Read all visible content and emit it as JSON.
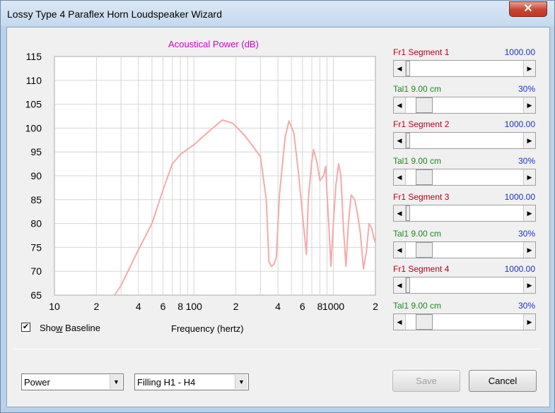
{
  "window": {
    "title": "Lossy Type 4 Paraflex Horn Loudspeaker Wizard",
    "close_glyph": "✕"
  },
  "chart_data": {
    "type": "line",
    "title": "Acoustical Power (dB)",
    "xlabel": "Frequency (hertz)",
    "ylabel": "",
    "x_scale": "log",
    "xlim": [
      10,
      2000
    ],
    "ylim": [
      65,
      115
    ],
    "yticks": [
      115,
      110,
      105,
      100,
      95,
      90,
      85,
      80,
      75,
      70,
      65
    ],
    "xtick_labels": [
      {
        "x": 10,
        "label": "10"
      },
      {
        "x": 20,
        "label": "2"
      },
      {
        "x": 40,
        "label": "4"
      },
      {
        "x": 60,
        "label": "6"
      },
      {
        "x": 80,
        "label": "8"
      },
      {
        "x": 100,
        "label": "100"
      },
      {
        "x": 200,
        "label": "2"
      },
      {
        "x": 400,
        "label": "4"
      },
      {
        "x": 600,
        "label": "6"
      },
      {
        "x": 800,
        "label": "8"
      },
      {
        "x": 1000,
        "label": "1000"
      },
      {
        "x": 2000,
        "label": "2"
      }
    ],
    "grid": true,
    "series": [
      {
        "color": "#f4aaaa",
        "points": [
          [
            27,
            65
          ],
          [
            30,
            67
          ],
          [
            40,
            74.5
          ],
          [
            50,
            80
          ],
          [
            60,
            87
          ],
          [
            70,
            92.5
          ],
          [
            80,
            94.5
          ],
          [
            100,
            96.5
          ],
          [
            130,
            99.5
          ],
          [
            160,
            101.7
          ],
          [
            190,
            101
          ],
          [
            230,
            98.5
          ],
          [
            260,
            96.5
          ],
          [
            300,
            94
          ],
          [
            330,
            85
          ],
          [
            345,
            72
          ],
          [
            360,
            71
          ],
          [
            375,
            71.5
          ],
          [
            390,
            73
          ],
          [
            410,
            86
          ],
          [
            450,
            98
          ],
          [
            480,
            101.5
          ],
          [
            520,
            99
          ],
          [
            560,
            91
          ],
          [
            600,
            82
          ],
          [
            640,
            73.5
          ],
          [
            660,
            85
          ],
          [
            700,
            93
          ],
          [
            720,
            95.5
          ],
          [
            760,
            93
          ],
          [
            800,
            89
          ],
          [
            850,
            90
          ],
          [
            880,
            92
          ],
          [
            900,
            86
          ],
          [
            930,
            79
          ],
          [
            960,
            71
          ],
          [
            990,
            78
          ],
          [
            1040,
            88
          ],
          [
            1090,
            92.5
          ],
          [
            1130,
            90
          ],
          [
            1180,
            79
          ],
          [
            1230,
            71
          ],
          [
            1280,
            80
          ],
          [
            1340,
            86
          ],
          [
            1420,
            85
          ],
          [
            1490,
            82
          ],
          [
            1560,
            78
          ],
          [
            1640,
            70.5
          ],
          [
            1720,
            74
          ],
          [
            1800,
            80
          ],
          [
            1880,
            79
          ],
          [
            1950,
            77
          ],
          [
            2000,
            76
          ]
        ]
      }
    ]
  },
  "baseline": {
    "label_pre": "Sho",
    "label_mnemonic": "w",
    "label_post": " Baseline",
    "checked": true,
    "check_glyph": "✔"
  },
  "segments": [
    {
      "fr_label": "Fr1",
      "name": "Segment 1",
      "fr_value": "1000.00",
      "fr_pos": 0,
      "tal_label": "Tal1",
      "tal_value": "9.00 cm",
      "tal_pct": "30%",
      "tal_pos": 0.1
    },
    {
      "fr_label": "Fr1",
      "name": "Segment 2",
      "fr_value": "1000.00",
      "fr_pos": 0,
      "tal_label": "Tal1",
      "tal_value": "9.00 cm",
      "tal_pct": "30%",
      "tal_pos": 0.1
    },
    {
      "fr_label": "Fr1",
      "name": "Segment 3",
      "fr_value": "1000.00",
      "fr_pos": 0,
      "tal_label": "Tal1",
      "tal_value": "9.00 cm",
      "tal_pct": "30%",
      "tal_pos": 0.1
    },
    {
      "fr_label": "Fr1",
      "name": "Segment 4",
      "fr_value": "1000.00",
      "fr_pos": 0,
      "tal_label": "Tal1",
      "tal_value": "9.00 cm",
      "tal_pct": "30%",
      "tal_pos": 0.1
    }
  ],
  "footer": {
    "mode_select": "Power",
    "filling_select": "Filling H1 - H4",
    "save_label": "Save",
    "cancel_label": "Cancel"
  },
  "icons": {
    "left_arrow": "◀",
    "right_arrow": "▶",
    "dropdown_arrow": "▼"
  },
  "colors": {
    "title": "#cc00cc",
    "curve": "#f4aaaa",
    "fr_label": "#b3001b",
    "tal_label": "#1a8a1a",
    "value": "#1a33c8"
  }
}
